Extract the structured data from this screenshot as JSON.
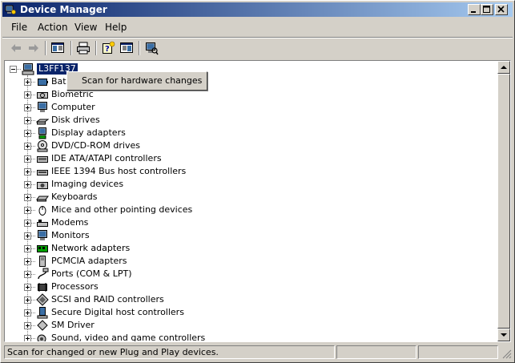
{
  "window": {
    "title": "Device Manager"
  },
  "menubar": {
    "items": [
      "File",
      "Action",
      "View",
      "Help"
    ]
  },
  "toolbar": {
    "icons": [
      "back-arrow-icon",
      "forward-arrow-icon",
      "show-hide-console-tree-icon",
      "print-icon",
      "help-icon",
      "properties-icon",
      "scan-hardware-icon"
    ]
  },
  "tree": {
    "root_label": "L3FF137",
    "categories": [
      {
        "label": "Bat",
        "icon": "battery-icon"
      },
      {
        "label": "Biometric",
        "icon": "biometric-icon"
      },
      {
        "label": "Computer",
        "icon": "computer-icon"
      },
      {
        "label": "Disk drives",
        "icon": "disk-drive-icon"
      },
      {
        "label": "Display adapters",
        "icon": "display-adapter-icon"
      },
      {
        "label": "DVD/CD-ROM drives",
        "icon": "dvd-drive-icon"
      },
      {
        "label": "IDE ATA/ATAPI controllers",
        "icon": "ide-controller-icon"
      },
      {
        "label": "IEEE 1394 Bus host controllers",
        "icon": "ieee1394-icon"
      },
      {
        "label": "Imaging devices",
        "icon": "imaging-device-icon"
      },
      {
        "label": "Keyboards",
        "icon": "keyboard-icon"
      },
      {
        "label": "Mice and other pointing devices",
        "icon": "mouse-icon"
      },
      {
        "label": "Modems",
        "icon": "modem-icon"
      },
      {
        "label": "Monitors",
        "icon": "monitor-icon"
      },
      {
        "label": "Network adapters",
        "icon": "network-adapter-icon"
      },
      {
        "label": "PCMCIA adapters",
        "icon": "pcmcia-icon"
      },
      {
        "label": "Ports (COM & LPT)",
        "icon": "port-icon"
      },
      {
        "label": "Processors",
        "icon": "processor-icon"
      },
      {
        "label": "SCSI and RAID controllers",
        "icon": "scsi-icon"
      },
      {
        "label": "Secure Digital host controllers",
        "icon": "sd-host-icon"
      },
      {
        "label": "SM Driver",
        "icon": "sm-driver-icon"
      },
      {
        "label": "Sound, video and game controllers",
        "icon": "sound-icon"
      }
    ]
  },
  "context_menu": {
    "items": [
      "Scan for hardware changes"
    ]
  },
  "statusbar": {
    "text": "Scan for changed or new Plug and Play devices."
  },
  "colors": {
    "titlebar_start": "#0a246a",
    "titlebar_end": "#a6caf0",
    "selection": "#0a246a",
    "face": "#d4d0c8"
  }
}
